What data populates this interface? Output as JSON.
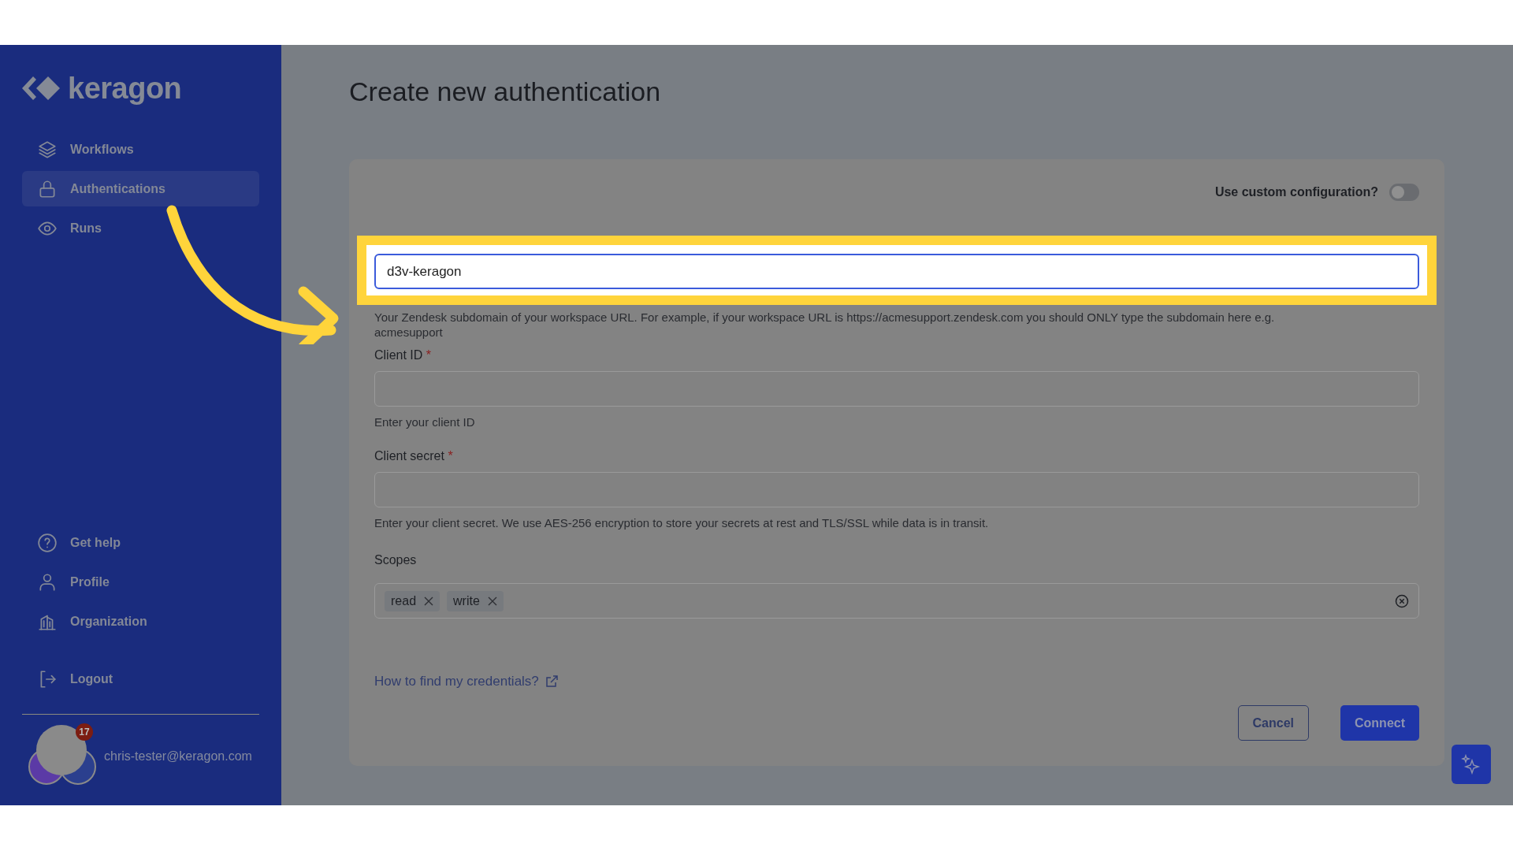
{
  "sidebar": {
    "logo": "keragon",
    "nav": [
      {
        "label": "Workflows",
        "selected": false
      },
      {
        "label": "Authentications",
        "selected": true
      },
      {
        "label": "Runs",
        "selected": false
      }
    ],
    "bottom_nav": [
      {
        "label": "Get help"
      },
      {
        "label": "Profile"
      },
      {
        "label": "Organization"
      }
    ],
    "logout": {
      "label": "Logout"
    },
    "user": {
      "email": "chris-tester@keragon.com",
      "badge": "17"
    }
  },
  "page": {
    "title": "Create new authentication"
  },
  "form": {
    "custom_config": {
      "label": "Use custom configuration?",
      "on": false
    },
    "subdomain": {
      "value": "d3v-keragon",
      "highlighted": true,
      "help": "Your Zendesk subdomain of your workspace URL. For example, if your workspace URL is https://acmesupport.zendesk.com you should ONLY type the subdomain here e.g. acmesupport"
    },
    "fields": [
      {
        "label": "Client ID",
        "required_mark": "*",
        "help": "Enter your client ID"
      },
      {
        "label": "Client secret",
        "required_mark": "*",
        "help": "Enter your client secret. We use AES-256 encryption to store your secrets at rest and TLS/SSL while data is in transit."
      }
    ],
    "scopes": {
      "label": "Scopes",
      "tags": [
        "read",
        "write"
      ]
    },
    "help_link": "How to find my credentials?",
    "buttons": [
      {
        "label": "Cancel",
        "kind": "secondary"
      },
      {
        "label": "Connect",
        "kind": "primary"
      }
    ]
  }
}
